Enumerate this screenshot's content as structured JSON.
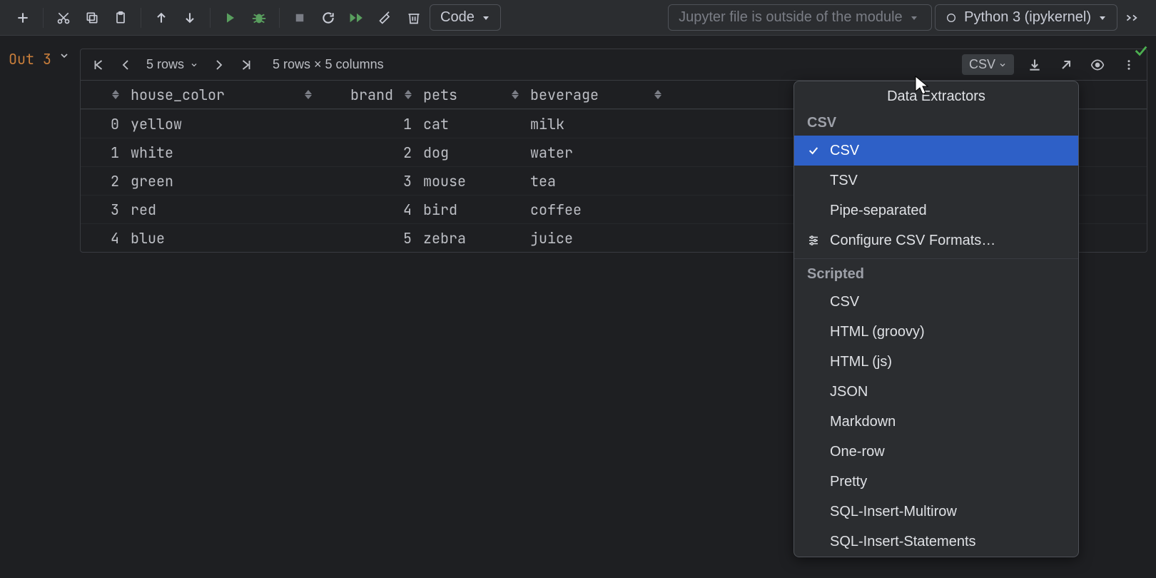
{
  "toolbar": {
    "cell_type": "Code",
    "module_notice": "Jupyter file is outside of the module",
    "kernel": "Python 3 (ipykernel)"
  },
  "output": {
    "label": "Out 3"
  },
  "panel": {
    "rows_label": "5 rows",
    "summary": "5 rows × 5 columns",
    "csv_label": "CSV"
  },
  "columns": [
    "house_color",
    "brand",
    "pets",
    "beverage"
  ],
  "rows": [
    {
      "idx": "0",
      "house_color": "yellow",
      "brand": "1",
      "pets": "cat",
      "beverage": "milk"
    },
    {
      "idx": "1",
      "house_color": "white",
      "brand": "2",
      "pets": "dog",
      "beverage": "water"
    },
    {
      "idx": "2",
      "house_color": "green",
      "brand": "3",
      "pets": "mouse",
      "beverage": "tea"
    },
    {
      "idx": "3",
      "house_color": "red",
      "brand": "4",
      "pets": "bird",
      "beverage": "coffee"
    },
    {
      "idx": "4",
      "house_color": "blue",
      "brand": "5",
      "pets": "zebra",
      "beverage": "juice"
    }
  ],
  "popup": {
    "title": "Data Extractors",
    "sections": {
      "csv": {
        "label": "CSV",
        "items": [
          "CSV",
          "TSV",
          "Pipe-separated",
          "Configure CSV Formats…"
        ]
      },
      "scripted": {
        "label": "Scripted",
        "items": [
          "CSV",
          "HTML (groovy)",
          "HTML (js)",
          "JSON",
          "Markdown",
          "One-row",
          "Pretty",
          "SQL-Insert-Multirow",
          "SQL-Insert-Statements"
        ]
      }
    }
  }
}
